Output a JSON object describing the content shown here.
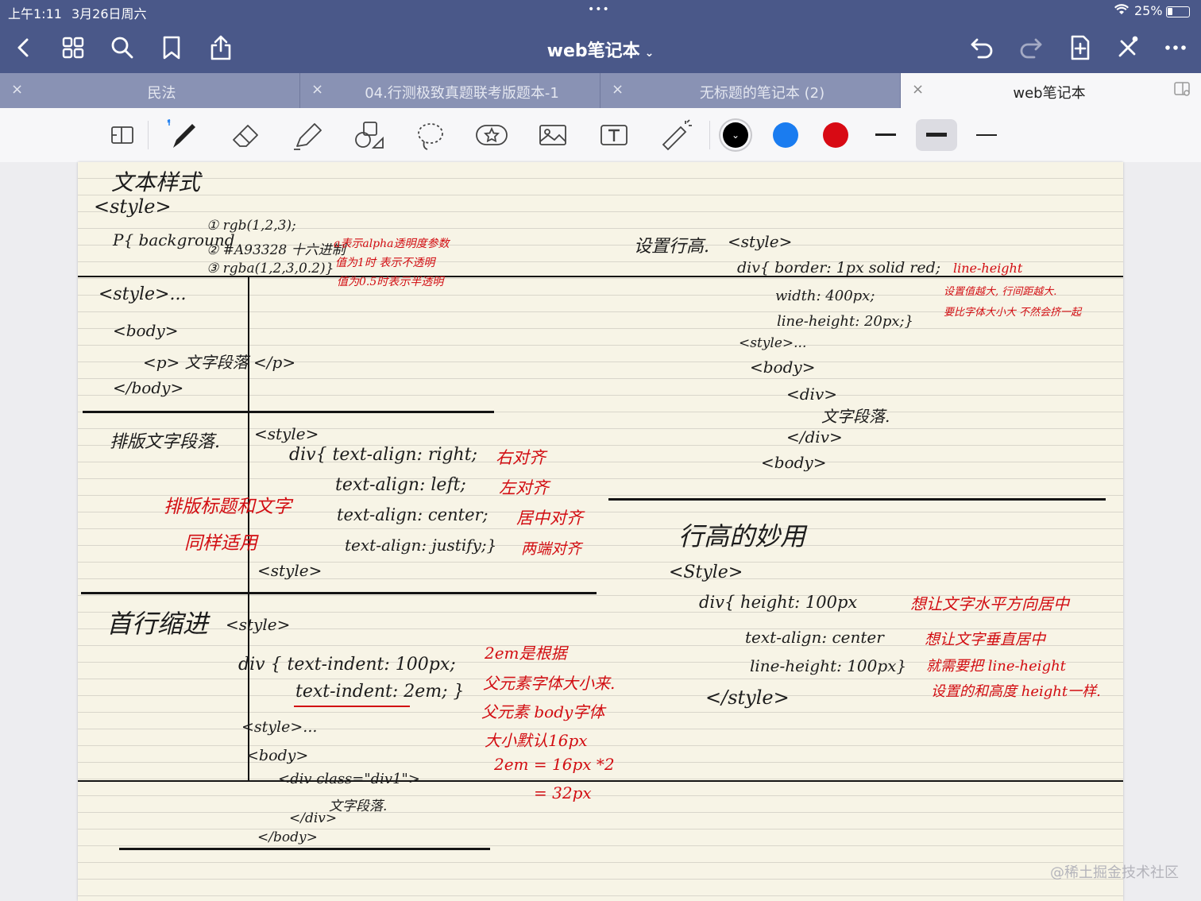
{
  "status": {
    "time": "上午1:11",
    "date": "3月26日周六",
    "dots": "•••",
    "battery": "25%",
    "battery_level": 0.25
  },
  "nav": {
    "title": "web笔记本",
    "title_chevron": "⌄"
  },
  "tabs": [
    {
      "label": "民法",
      "close": "×"
    },
    {
      "label": "04.行测极致真题联考版题本-1",
      "close": "×"
    },
    {
      "label": "无标题的笔记本 (2)",
      "close": "×"
    },
    {
      "label": "web笔记本",
      "close": "×",
      "active": true
    }
  ],
  "toolbar": {
    "tools": [
      "page-layout-icon",
      "pen-icon",
      "eraser-icon",
      "highlighter-icon",
      "shapes-icon",
      "lasso-icon",
      "sticker-icon",
      "image-icon",
      "text-box-icon",
      "laser-pointer-icon"
    ],
    "colors": [
      "#000000",
      "#1a7cf0",
      "#d80a14"
    ],
    "selected_color_mark": "⌄",
    "pen_widths": [
      "thin",
      "medium",
      "thick"
    ],
    "selected_width": "medium"
  },
  "colors": {
    "bar": "#4a5889",
    "tabs": "#8992b4",
    "ink_red": "#d20d12",
    "paper": "#f7f4e6"
  },
  "note": {
    "left": {
      "title": "文本样式",
      "style_open": "<style>",
      "bg_prefix": "P{ background",
      "bg1": "① rgb(1,2,3);",
      "bg2": "② #A93328  十六进制",
      "bg3": "③ rgba(1,2,3,0.2)}",
      "bg_red1": "a表示alpha透明度参数",
      "bg_red2": "值为1时 表示不透明",
      "bg_red3": "值为0.5时表示半透明",
      "s1_style": "<style>...",
      "s1_body": "<body>",
      "s1_p": "<p> 文字段落 </p>",
      "s1_body_end": "</body>",
      "layout_title": "排版文字段落.",
      "layout_style": "<style>",
      "layout_1": "div{ text-align: right;",
      "layout_1r": "右对齐",
      "layout_2": "text-align: left;",
      "layout_2r": "左对齐",
      "layout_3": "text-align: center;",
      "layout_3r": "居中对齐",
      "layout_4": "text-align: justify;}",
      "layout_4r": "两端对齐",
      "layout_end": "<style>",
      "layout_red1": "排版标题和文字",
      "layout_red2": "同样适用",
      "indent_title": "首行缩进",
      "indent_style": "<style>",
      "indent_1": "div { text-indent: 100px;",
      "indent_2": "text-indent: 2em; }",
      "indent_3": "<style>...",
      "indent_4": "<body>",
      "indent_5": "<div class=\"div1\">",
      "indent_6": "文字段落.",
      "indent_7": "</div>",
      "indent_8": "</body>",
      "indent_red1": "2em是根据",
      "indent_red2": "父元素字体大小来.",
      "indent_red3": "父元素 body字体",
      "indent_red4": "大小默认16px",
      "indent_red5": "2em = 16px *2",
      "indent_red6": "= 32px"
    },
    "right": {
      "lh_title": "设置行高.",
      "lh_style": "<style>",
      "lh_1": "div{ border: 1px solid red;",
      "lh_2": "width: 400px;",
      "lh_3": "line-height: 20px;}",
      "lh_4": "<style>...",
      "lh_5": "<body>",
      "lh_6": "<div>",
      "lh_7": "文字段落.",
      "lh_8": "</div>",
      "lh_9": "<body>",
      "lh_red1": "line-height",
      "lh_red2": "设置值越大, 行间距越大.",
      "lh_red3": "要比字体大小大 不然会挤一起",
      "use_title": "行高的妙用",
      "use_style": "<Style>",
      "use_1": "div{   height: 100px",
      "use_2": "text-align: center",
      "use_3": "line-height: 100px}",
      "use_4": "</style>",
      "use_red1": "想让文字水平方向居中",
      "use_red2": "想让文字垂直居中",
      "use_red3": "就需要把 line-height",
      "use_red4": "设置的和高度 height一样."
    }
  },
  "watermark": "@稀土掘金技术社区"
}
